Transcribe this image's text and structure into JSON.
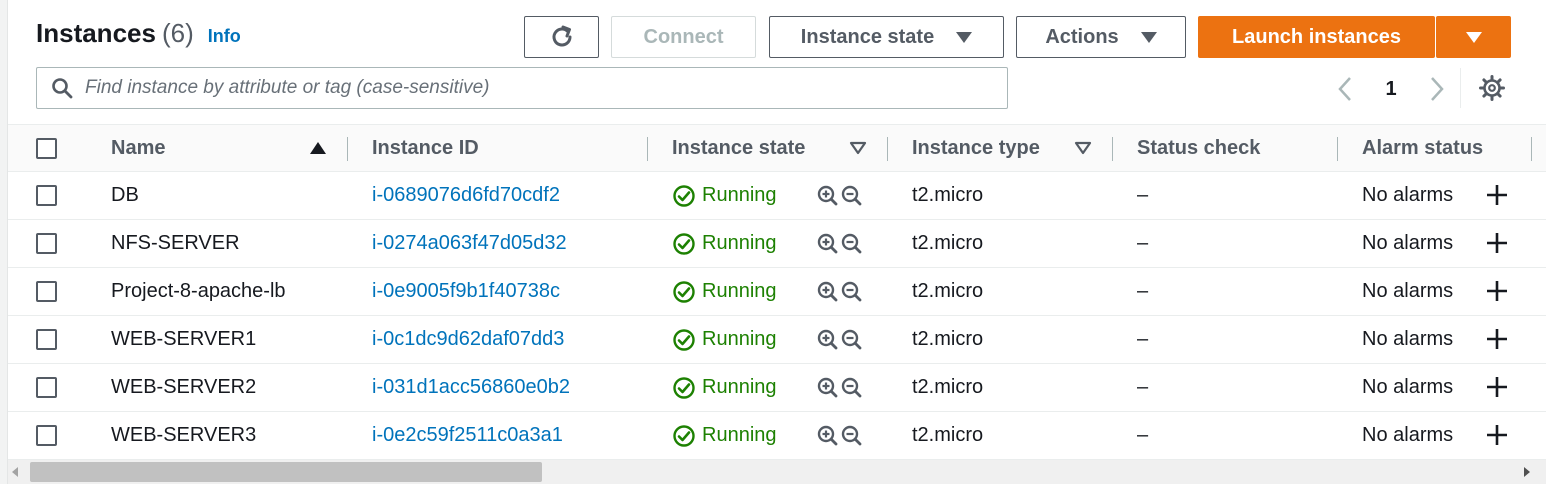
{
  "header": {
    "title": "Instances",
    "count": "(6)",
    "info": "Info"
  },
  "toolbar": {
    "refresh_icon": "refresh-icon",
    "connect_label": "Connect",
    "instance_state_label": "Instance state",
    "actions_label": "Actions",
    "launch_label": "Launch instances"
  },
  "search": {
    "placeholder": "Find instance by attribute or tag (case-sensitive)",
    "value": ""
  },
  "pagination": {
    "page": "1"
  },
  "table": {
    "columns": [
      "Name",
      "Instance ID",
      "Instance state",
      "Instance type",
      "Status check",
      "Alarm status"
    ],
    "sort_column": "Name",
    "sort_direction": "ascending",
    "rows": [
      {
        "name": "DB",
        "instance_id": "i-0689076d6fd70cdf2",
        "state": "Running",
        "type": "t2.micro",
        "status_check": "–",
        "alarm": "No alarms"
      },
      {
        "name": "NFS-SERVER",
        "instance_id": "i-0274a063f47d05d32",
        "state": "Running",
        "type": "t2.micro",
        "status_check": "–",
        "alarm": "No alarms"
      },
      {
        "name": "Project-8-apache-lb",
        "instance_id": "i-0e9005f9b1f40738c",
        "state": "Running",
        "type": "t2.micro",
        "status_check": "–",
        "alarm": "No alarms"
      },
      {
        "name": "WEB-SERVER1",
        "instance_id": "i-0c1dc9d62daf07dd3",
        "state": "Running",
        "type": "t2.micro",
        "status_check": "–",
        "alarm": "No alarms"
      },
      {
        "name": "WEB-SERVER2",
        "instance_id": "i-031d1acc56860e0b2",
        "state": "Running",
        "type": "t2.micro",
        "status_check": "–",
        "alarm": "No alarms"
      },
      {
        "name": "WEB-SERVER3",
        "instance_id": "i-0e2c59f2511c0a3a1",
        "state": "Running",
        "type": "t2.micro",
        "status_check": "–",
        "alarm": "No alarms"
      }
    ]
  },
  "colors": {
    "primary_orange": "#ec7211",
    "link_blue": "#0073bb",
    "running_green": "#1d8102",
    "text_dark": "#16191f",
    "text_gray": "#545b64"
  }
}
